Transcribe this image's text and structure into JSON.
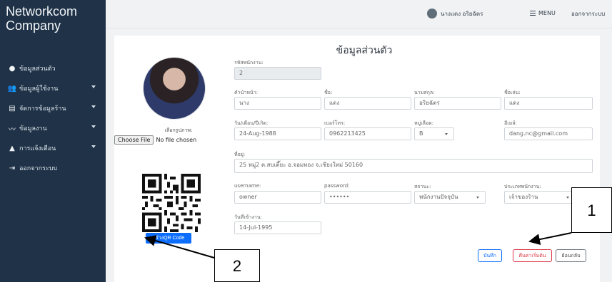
{
  "sidebar": {
    "brand": "Networkcom Company",
    "items": [
      {
        "label": "ข้อมูลส่วนตัว",
        "icon": "user-circle-icon",
        "has_caret": false
      },
      {
        "label": "ข้อมูลผู้ใช้งาน",
        "icon": "users-icon",
        "has_caret": true
      },
      {
        "label": "จัดการข้อมูลร้าน",
        "icon": "file-icon",
        "has_caret": true
      },
      {
        "label": "ข้อมูลงาน",
        "icon": "line-chart-icon",
        "has_caret": true
      },
      {
        "label": "การแจ้งเตือน",
        "icon": "bell-icon",
        "has_caret": true
      },
      {
        "label": "ออกจากระบบ",
        "icon": "sign-out-icon",
        "has_caret": false
      }
    ]
  },
  "topbar": {
    "user_name": "นางแดง อริยฉัตร",
    "menu_label": "MENU",
    "logout_label": "ออกจากระบบ"
  },
  "page": {
    "title": "ข้อมูลส่วนตัว",
    "photo_label": "เลือกรูปภาพ:",
    "file_button": "Choose File",
    "file_status": "No file chosen",
    "qr_button": "สร้างQR Code"
  },
  "form": {
    "employee_id": {
      "label": "รหัสพนักงาน:",
      "value": "2"
    },
    "prefix": {
      "label": "คำนำหน้า:",
      "value": "นาง"
    },
    "first_name": {
      "label": "ชื่อ:",
      "value": "แดง"
    },
    "last_name": {
      "label": "นามสกุล:",
      "value": "อริยฉัตร"
    },
    "nickname": {
      "label": "ชื่อเล่น:",
      "value": "แดง"
    },
    "birthdate": {
      "label": "วัน/เดือน/ปีเกิด:",
      "value": "24-Aug-1988"
    },
    "phone": {
      "label": "เบอร์โทร:",
      "value": "0962213425"
    },
    "blood": {
      "label": "หมู่เลือด:",
      "value": "B"
    },
    "email": {
      "label": "อีเมล์:",
      "value": "dang.nc@gmail.com"
    },
    "address": {
      "label": "ที่อยู่:",
      "value": "25 หมู่2 ต.สบเตี๊ยะ อ.จอมทอง จ.เชียงใหม่ 50160"
    },
    "username": {
      "label": "username:",
      "value": "owner"
    },
    "password": {
      "label": "password:",
      "value": "••••••"
    },
    "status": {
      "label": "สถานะ:",
      "value": "พนักงานปัจจุบัน"
    },
    "employee_type": {
      "label": "ประเภทพนักงาน:",
      "value": "เจ้าของร้าน"
    },
    "start_date": {
      "label": "วันที่เข้างาน:",
      "value": "14-Jul-1995"
    }
  },
  "buttons": {
    "save": "บันทึก",
    "reset": "คืนค่าเริ่มต้น",
    "back": "ย้อนกลับ"
  },
  "annotations": {
    "one": "1",
    "two": "2"
  }
}
